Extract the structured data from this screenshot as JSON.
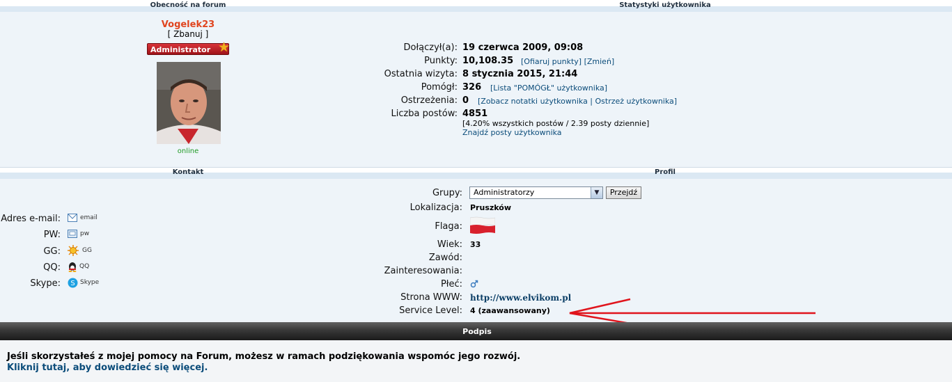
{
  "sections": {
    "presence": "Obecność na forum",
    "stats": "Statystyki użytkownika",
    "contact": "Kontakt",
    "profile": "Profil",
    "signature": "Podpis"
  },
  "user": {
    "name": "Vogelek23",
    "ban": "[ Zbanuj ]",
    "rank": "Administrator",
    "status": "online"
  },
  "stats": {
    "joined_label": "Dołączył(a):",
    "joined_value": "19 czerwca 2009, 09:08",
    "points_label": "Punkty:",
    "points_value": "10,108.35",
    "points_links": "[Ofiaruj punkty] [Zmień]",
    "last_visit_label": "Ostatnia wizyta:",
    "last_visit_value": "8 stycznia 2015, 21:44",
    "helped_label": "Pomógł:",
    "helped_value": "326",
    "helped_link": "[Lista \"POMÓGŁ\" użytkownika]",
    "warnings_label": "Ostrzeżenia:",
    "warnings_value": "0",
    "warnings_links": "[Zobacz notatki użytkownika | Ostrzeż użytkownika]",
    "posts_label": "Liczba postów:",
    "posts_value": "4851",
    "posts_detail": "[4.20% wszystkich postów / 2.39 posty dziennie]",
    "posts_find": "Znajdź posty użytkownika"
  },
  "contact": {
    "email_label": "Adres e-mail:",
    "email_text": "email",
    "pw_label": "PW:",
    "pw_text": "pw",
    "gg_label": "GG:",
    "gg_text": "GG",
    "qq_label": "QQ:",
    "qq_text": "QQ",
    "skype_label": "Skype:",
    "skype_text": "Skype"
  },
  "profile": {
    "groups_label": "Grupy:",
    "groups_value": "Administratorzy",
    "go_button": "Przejdź",
    "location_label": "Lokalizacja:",
    "location_value": "Pruszków",
    "flag_label": "Flaga:",
    "age_label": "Wiek:",
    "age_value": "33",
    "job_label": "Zawód:",
    "interests_label": "Zainteresowania:",
    "gender_label": "Płeć:",
    "www_label": "Strona WWW:",
    "www_value": "http://www.elvikom.pl",
    "service_label": "Service Level:",
    "service_value": "4 (zaawansowany)"
  },
  "signature": {
    "line1": "Jeśli skorzystałeś z mojej pomocy na Forum, możesz w ramach podziękowania wspomóc jego rozwój.",
    "line2": "Kliknij tutaj, aby dowiedzieć się więcej."
  },
  "colors": {
    "arrow": "#e0141c",
    "link": "#0b4c7a",
    "username": "#e0451f"
  }
}
